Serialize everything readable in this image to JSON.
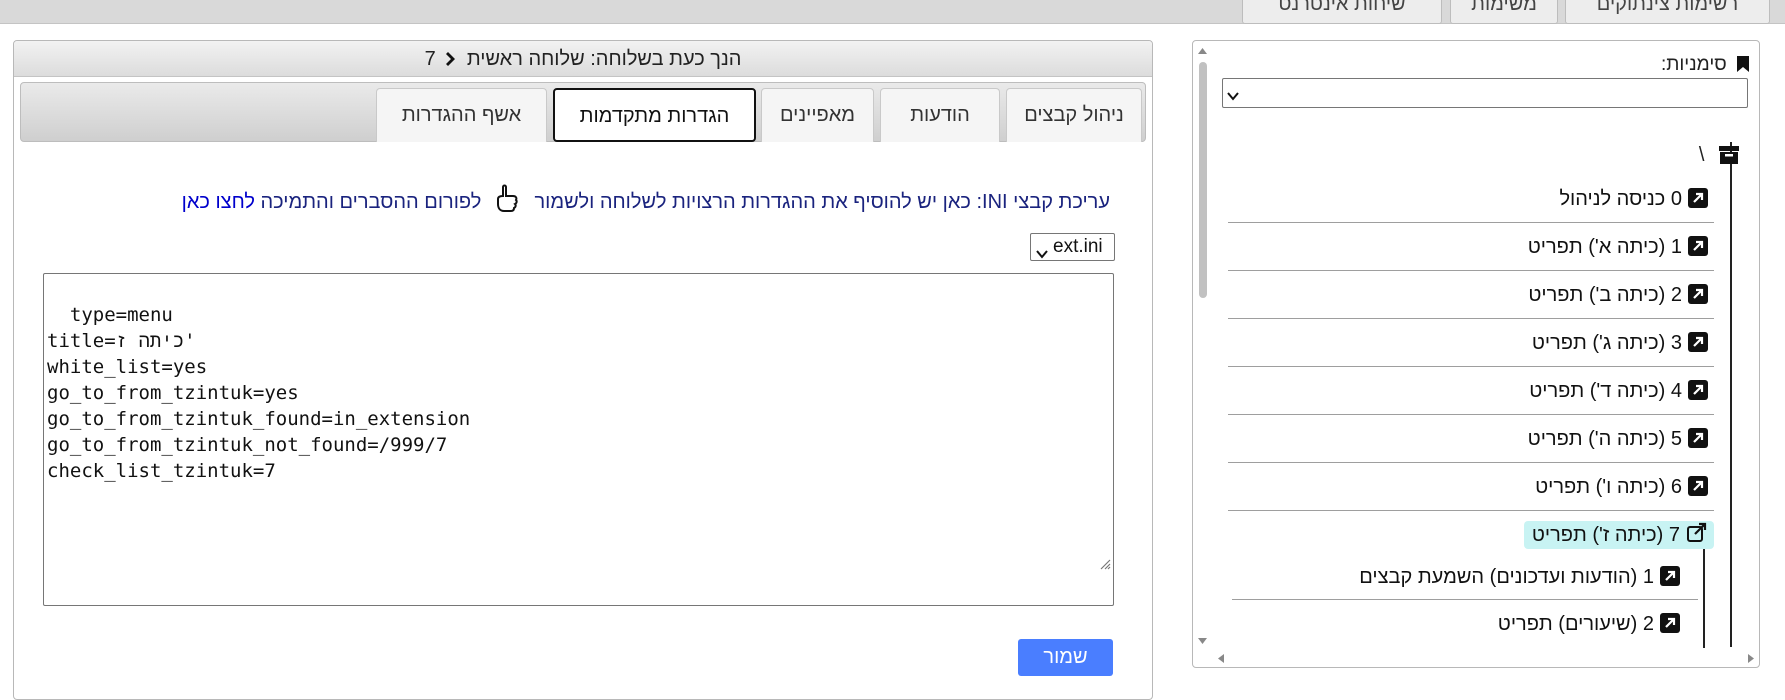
{
  "top_tabs": [
    "רשימות צינתוקים",
    "משימות",
    "שיחות אינטרנט"
  ],
  "header": {
    "prefix": "הנך כעת בשלוחה:",
    "root_label": "שלוחה ראשית",
    "chevron_icon": "chevron-right-icon",
    "current_extension": "7"
  },
  "tabs": [
    {
      "label": "ניהול קבצים",
      "active": false
    },
    {
      "label": "הודעות",
      "active": false
    },
    {
      "label": "מאפיינים",
      "active": false
    },
    {
      "label": "הגדרות מתקדמות",
      "active": true
    },
    {
      "label": "אשף ההגדרות",
      "active": false
    }
  ],
  "ini_help": {
    "prefix": "עריכת קבצי INI: כאן יש להוסיף את ההגדרות הרצויות לשלוחה ולשמור",
    "icon": "pointing-hand-icon",
    "forum_text": "לפורום ההסברים והתמיכה",
    "link_text": "לחצו כאן"
  },
  "file_select": {
    "value": "ext.ini"
  },
  "editor": {
    "content": "type=menu\ntitle=כיתה ז'\nwhite_list=yes\ngo_to_from_tzintuk=yes\ngo_to_from_tzintuk_found=in_extension\ngo_to_from_tzintuk_not_found=/999/7\ncheck_list_tzintuk=7"
  },
  "save_label": "שמור",
  "sidebar": {
    "bookmarks_label": "סימניות:",
    "bookmarks_icon": "bookmark-icon",
    "bookmarks_value": "",
    "root": {
      "icon": "archive-icon",
      "label": "\\"
    },
    "items": [
      {
        "number": "0",
        "label": "כניסה לניהול",
        "icon": "external-link-square-icon",
        "selected": false
      },
      {
        "number": "1",
        "label": "(כיתה א') תפריט",
        "icon": "external-link-square-icon",
        "selected": false
      },
      {
        "number": "2",
        "label": "(כיתה ב') תפריט",
        "icon": "external-link-square-icon",
        "selected": false
      },
      {
        "number": "3",
        "label": "(כיתה ג') תפריט",
        "icon": "external-link-square-icon",
        "selected": false
      },
      {
        "number": "4",
        "label": "(כיתה ד') תפריט",
        "icon": "external-link-square-icon",
        "selected": false
      },
      {
        "number": "5",
        "label": "(כיתה ה') תפריט",
        "icon": "external-link-square-icon",
        "selected": false
      },
      {
        "number": "6",
        "label": "(כיתה ו') תפריט",
        "icon": "external-link-square-icon",
        "selected": false
      },
      {
        "number": "7",
        "label": "(כיתה ז') תפריט",
        "icon": "external-link-icon",
        "selected": true
      }
    ],
    "sub_items": [
      {
        "number": "1",
        "label": "(הודעות ועדכונים) השמעת קבצים",
        "icon": "external-link-square-icon"
      },
      {
        "number": "2",
        "label": "(שיעורים) תפריט",
        "icon": "external-link-square-icon"
      }
    ]
  },
  "colors": {
    "save_button": "#4a7eff",
    "link": "#0000cc",
    "selected_row": "#c8f3f3"
  }
}
